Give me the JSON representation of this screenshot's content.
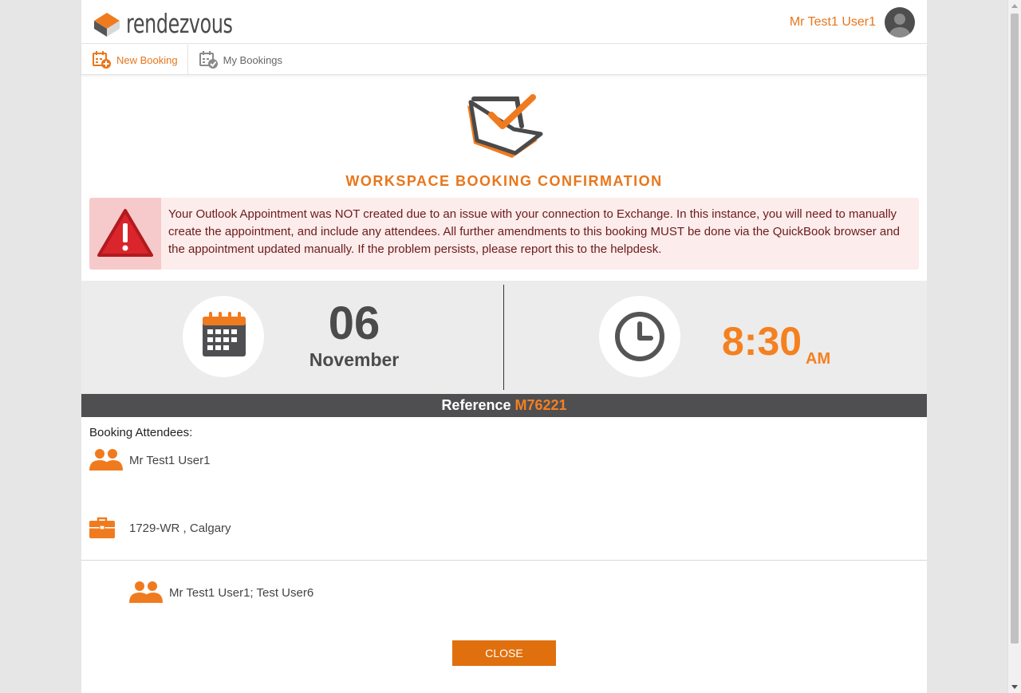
{
  "header": {
    "logo_text": "rendezvous",
    "user_name": "Mr Test1 User1"
  },
  "nav": {
    "items": [
      {
        "label": "New Booking",
        "active": true
      },
      {
        "label": "My Bookings",
        "active": false
      }
    ]
  },
  "confirmation": {
    "title": "WORKSPACE BOOKING CONFIRMATION"
  },
  "alert": {
    "message": "Your Outlook Appointment was NOT created due to an issue with your connection to Exchange. In this instance, you will need to manually create the appointment, and include any attendees. All further amendments to this booking MUST be done via the QuickBook browser and the appointment updated manually. If the problem persists, please report this to the helpdesk."
  },
  "booking": {
    "day": "06",
    "month": "November",
    "time": "8:30",
    "ampm": "AM",
    "reference_label": "Reference",
    "reference_value": "M76221",
    "attendees_label": "Booking Attendees:",
    "organizer": "Mr Test1 User1",
    "location": "1729-WR , Calgary",
    "attendees": "Mr Test1 User1; Test User6"
  },
  "actions": {
    "close_label": "CLOSE"
  },
  "colors": {
    "accent": "#e8761b",
    "dark_bar": "#4f4f52",
    "alert_bg": "#fdecec",
    "alert_text": "#6b1b1b"
  }
}
